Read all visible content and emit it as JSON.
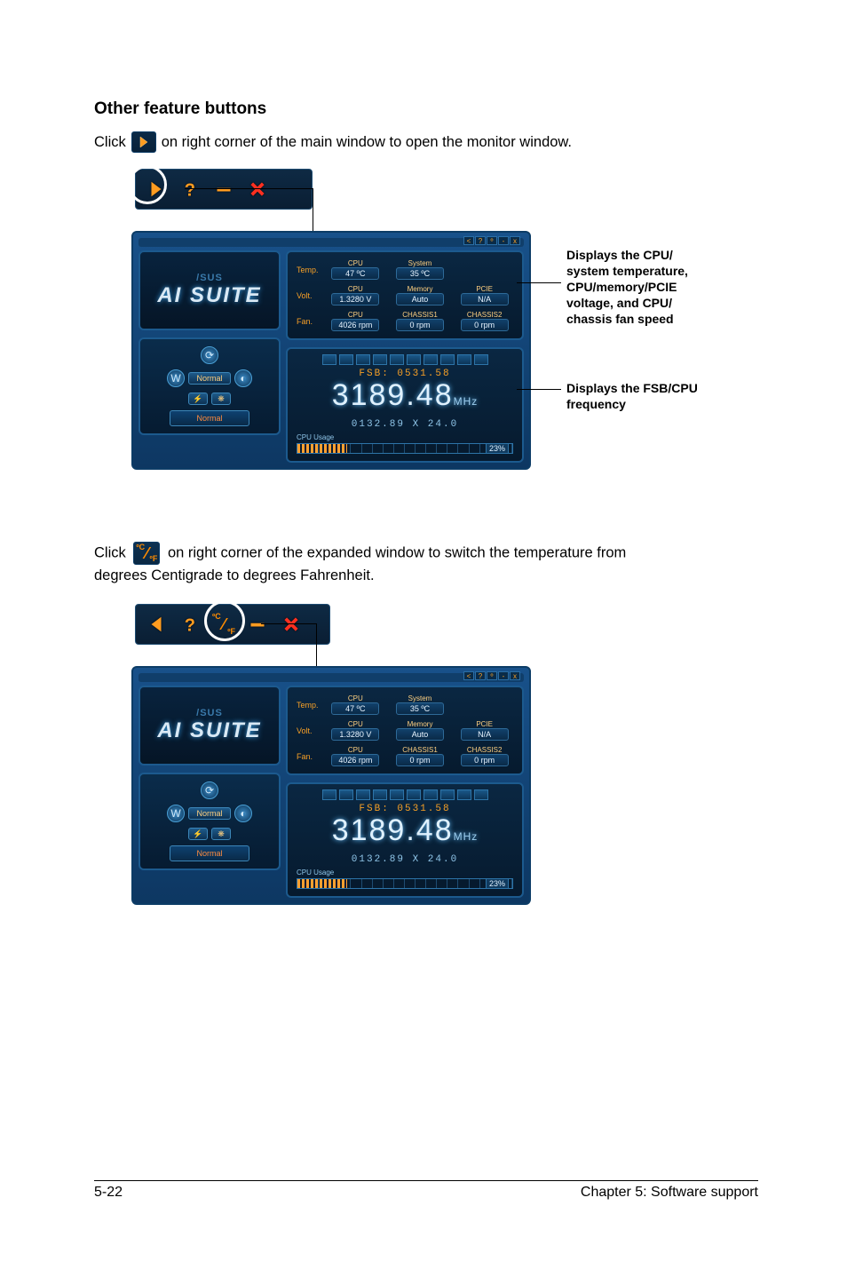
{
  "section_heading": "Other feature buttons",
  "instr1_prefix": "Click",
  "instr1_suffix": "on right corner of the main window to open the monitor window.",
  "instr2_prefix": "Click",
  "instr2_mid": "on right corner of the expanded window to switch the temperature from",
  "instr2_line2": "degrees Centigrade to degrees Fahrenheit.",
  "callout_sensors_l1": "Displays the CPU/",
  "callout_sensors_l2": "system temperature,",
  "callout_sensors_l3": "CPU/memory/PCIE",
  "callout_sensors_l4": "voltage, and CPU/",
  "callout_sensors_l5": "chassis fan speed",
  "callout_freq_l1": "Displays the FSB/CPU",
  "callout_freq_l2": "frequency",
  "logo_asus": "/SUS",
  "logo_suite": "AI SUITE",
  "normal_label": "Normal",
  "sensors": {
    "row_temp": "Temp.",
    "row_volt": "Volt.",
    "row_fan": "Fan.",
    "cpu_hdr": "CPU",
    "system_hdr": "System",
    "memory_hdr": "Memory",
    "pcie_hdr": "PCIE",
    "chassis1_hdr": "CHASSIS1",
    "chassis2_hdr": "CHASSIS2",
    "cpu_temp": "47 ºC",
    "sys_temp": "35 ºC",
    "cpu_volt": "1.3280 V",
    "mem_volt": "Auto",
    "pcie_volt": "N/A",
    "cpu_fan": "4026 rpm",
    "ch1_fan": "0 rpm",
    "ch2_fan": "0 rpm"
  },
  "freq": {
    "fsb_label": "FSB: 0531.58",
    "big": "3189.48",
    "mhz": "MHz",
    "mult": "0132.89 X 24.0",
    "cpu_usage_label": "CPU Usage",
    "pct": "23%"
  },
  "tf_c": "ºC",
  "tf_f": "ºF",
  "footer_left": "5-22",
  "footer_right": "Chapter 5: Software support"
}
